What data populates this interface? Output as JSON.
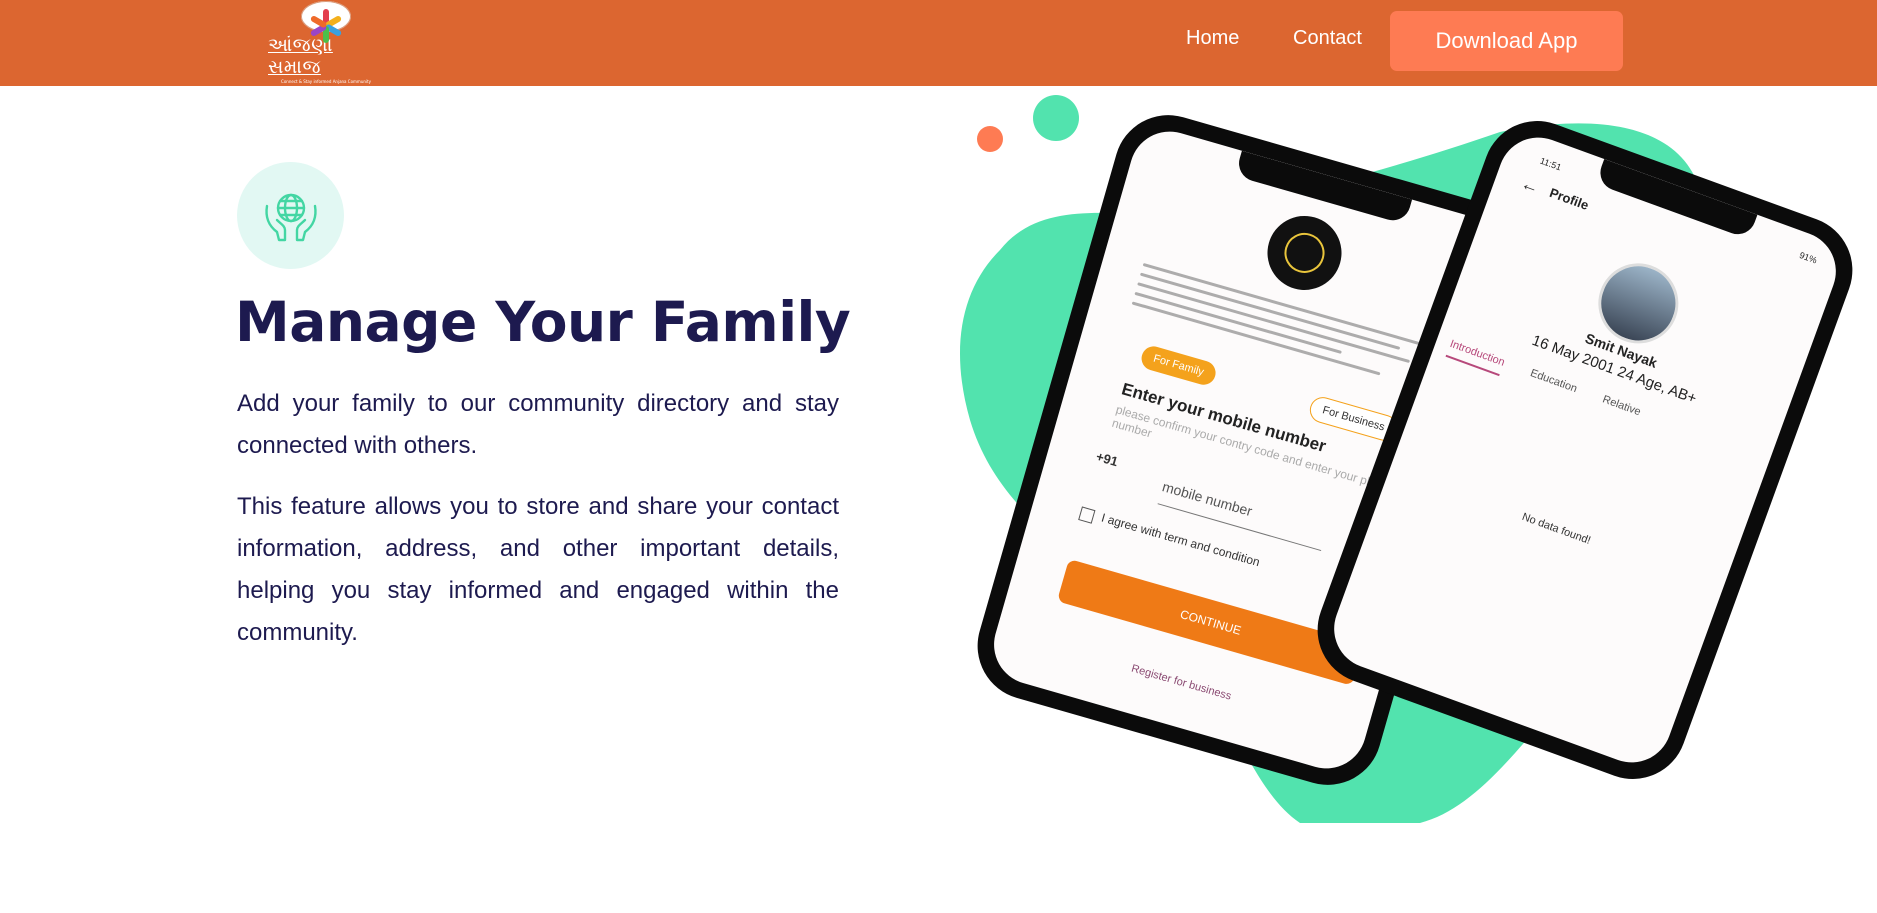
{
  "header": {
    "logo_text": "આંજણા સમાજ",
    "logo_tagline": "Connect & Stay informed Anjana Community",
    "nav": [
      {
        "label": "Home"
      },
      {
        "label": "Contact"
      }
    ],
    "download_button": "Download App",
    "colors": {
      "bar": "#dc6630",
      "button": "#fe7b53"
    }
  },
  "feature": {
    "icon": "globe-in-hands-icon",
    "title": "Manage Your Family",
    "paragraphs": [
      "Add your family to our community directory and stay connected with others.",
      "This feature allows you to store and share your contact information, address, and other important details, helping you stay informed and engaged within the community."
    ]
  },
  "phone_login": {
    "chip_family": "For Family",
    "chip_business": "For Business",
    "heading": "Enter your mobile number",
    "subtext": "please confirm your contry code and enter your phone number",
    "country_code": "+91",
    "mobile_placeholder": "mobile number",
    "agree_text": "I agree with term and condition",
    "continue_button": "CONTINUE",
    "register_link": "Register for business"
  },
  "phone_profile": {
    "time": "11:51",
    "battery": "91%",
    "title": "Profile",
    "name": "Smit Nayak",
    "dob_line": "16 May 2001 24 Age, AB+",
    "tabs": [
      "Introduction",
      "Education",
      "Relative"
    ],
    "empty_text": "No data found!"
  },
  "decor_colors": {
    "blob": "#52e3ae",
    "dot_orange": "#fe7b53",
    "dot_green": "#52e3ae"
  }
}
